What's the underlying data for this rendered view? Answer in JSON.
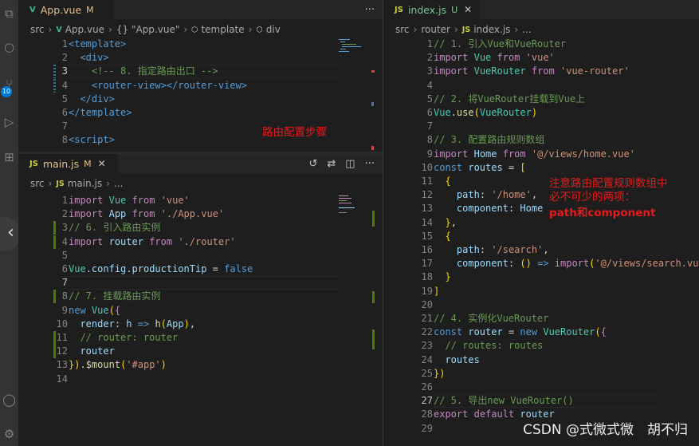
{
  "panes": {
    "app_vue": {
      "tab": {
        "icon": "V",
        "name": "App.vue",
        "status": "M",
        "icon_color": "#41b883"
      },
      "breadcrumb": [
        "src",
        "App.vue",
        "{} \"App.vue\"",
        "template",
        "div"
      ],
      "lines": [
        {
          "n": "1",
          "html": "<span class='t'>&lt;template&gt;</span>"
        },
        {
          "n": "2",
          "html": "  <span class='t'>&lt;div&gt;</span>"
        },
        {
          "n": "3",
          "html": "    <span class='c'>&lt;!-- 8. 指定路由出口 --&gt;</span>"
        },
        {
          "n": "4",
          "html": "    <span class='t'>&lt;router-view&gt;&lt;/router-view&gt;</span>"
        },
        {
          "n": "5",
          "html": "  <span class='t'>&lt;/div&gt;</span>"
        },
        {
          "n": "6",
          "html": "<span class='t'>&lt;/template&gt;</span>"
        },
        {
          "n": "7",
          "html": ""
        },
        {
          "n": "8",
          "html": "<span class='t'>&lt;script&gt;</span>"
        }
      ],
      "active_line": "3",
      "annotation": "路由配置步骤"
    },
    "main_js": {
      "tab": {
        "icon": "JS",
        "name": "main.js",
        "status": "M",
        "icon_color": "#cbcb41"
      },
      "breadcrumb": [
        "src",
        "main.js",
        "..."
      ],
      "lines": [
        {
          "n": "1",
          "text": "import Vue from 'vue'"
        },
        {
          "n": "2",
          "text": "import App from './App.vue'"
        },
        {
          "n": "3",
          "text": "// 6. 引入路由实例"
        },
        {
          "n": "4",
          "text": "import router from './router'"
        },
        {
          "n": "5",
          "text": ""
        },
        {
          "n": "6",
          "text": "Vue.config.productionTip = false"
        },
        {
          "n": "7",
          "text": ""
        },
        {
          "n": "8",
          "text": "// 7. 挂载路由实例"
        },
        {
          "n": "9",
          "text": "new Vue({"
        },
        {
          "n": "10",
          "text": "  render: h => h(App),"
        },
        {
          "n": "11",
          "text": "  // router: router"
        },
        {
          "n": "12",
          "text": "  router"
        },
        {
          "n": "13",
          "text": "}).$mount('#app')"
        },
        {
          "n": "14",
          "text": ""
        }
      ],
      "active_line": "7"
    },
    "index_js": {
      "tab": {
        "icon": "JS",
        "name": "index.js",
        "status": "U",
        "icon_color": "#cbcb41"
      },
      "breadcrumb": [
        "src",
        "router",
        "index.js",
        "..."
      ],
      "lines": [
        {
          "n": "1",
          "text": "// 1. 引入Vue和VueRouter"
        },
        {
          "n": "2",
          "text": "import Vue from 'vue'"
        },
        {
          "n": "3",
          "text": "import VueRouter from 'vue-router'"
        },
        {
          "n": "4",
          "text": ""
        },
        {
          "n": "5",
          "text": "// 2. 将VueRouter挂载到Vue上"
        },
        {
          "n": "6",
          "text": "Vue.use(VueRouter)"
        },
        {
          "n": "7",
          "text": ""
        },
        {
          "n": "8",
          "text": "// 3. 配置路由规则数组"
        },
        {
          "n": "9",
          "text": "import Home from '@/views/home.vue'"
        },
        {
          "n": "10",
          "text": "const routes = ["
        },
        {
          "n": "11",
          "text": "  {"
        },
        {
          "n": "12",
          "text": "    path: '/home',"
        },
        {
          "n": "13",
          "text": "    component: Home"
        },
        {
          "n": "14",
          "text": "  },"
        },
        {
          "n": "15",
          "text": "  {"
        },
        {
          "n": "16",
          "text": "    path: '/search',"
        },
        {
          "n": "17",
          "text": "    component: () => import('@/views/search.vue')"
        },
        {
          "n": "18",
          "text": "  }"
        },
        {
          "n": "19",
          "text": "]"
        },
        {
          "n": "20",
          "text": ""
        },
        {
          "n": "21",
          "text": "// 4. 实例化VueRouter"
        },
        {
          "n": "22",
          "text": "const router = new VueRouter({"
        },
        {
          "n": "23",
          "text": "  // routes: routes"
        },
        {
          "n": "24",
          "text": "  routes"
        },
        {
          "n": "25",
          "text": "})"
        },
        {
          "n": "26",
          "text": ""
        },
        {
          "n": "27",
          "text": "// 5. 导出new VueRouter()"
        },
        {
          "n": "28",
          "text": "export default router"
        },
        {
          "n": "29",
          "text": ""
        }
      ],
      "active_line": "27",
      "annotation": [
        "注意路由配置规则数组中",
        "必不可少的两项：",
        "path和component"
      ]
    }
  },
  "activity_bar": {
    "badge": "10",
    "icons": [
      "files-icon",
      "search-icon",
      "source-control-icon",
      "run-debug-icon",
      "extensions-icon",
      "account-icon",
      "settings-gear-icon"
    ]
  },
  "watermark": "CSDN @式微式微　胡不归",
  "colors": {
    "keyword": "#c586c0",
    "string": "#ce9178",
    "comment": "#6a9955",
    "variable": "#9cdcfe",
    "class": "#4ec9b0",
    "tag": "#569cd6",
    "bracket": "#ffd700",
    "function": "#dcdcaa",
    "annotation": "#e8191b"
  }
}
